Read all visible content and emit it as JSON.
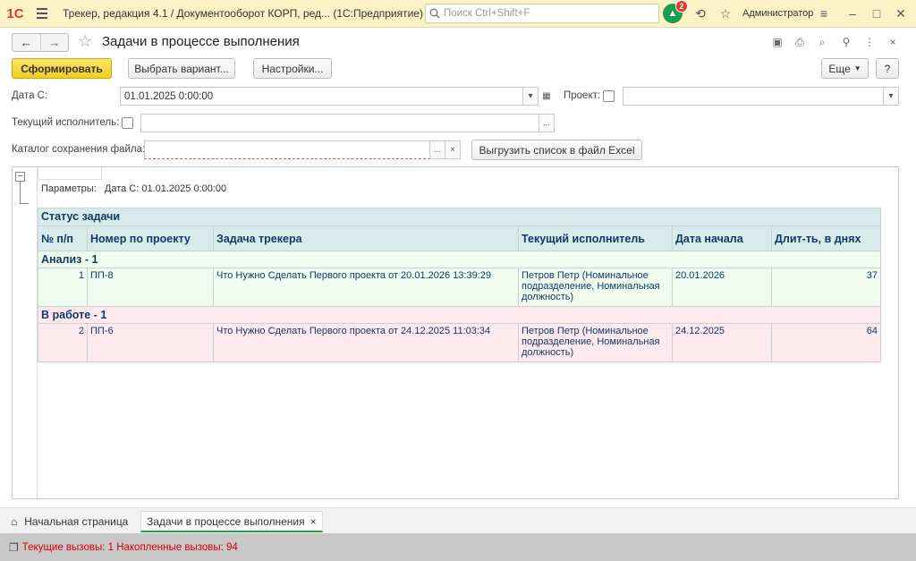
{
  "app": {
    "logo": "1С",
    "title": "Трекер, редакция 4.1 / Документооборот КОРП, ред... (1С:Предприятие)",
    "search_placeholder": "Поиск Ctrl+Shift+F",
    "notifications_count": "2",
    "user": "Администратор"
  },
  "form": {
    "title": "Задачи в процессе выполнения"
  },
  "toolbar": {
    "generate": "Сформировать",
    "choose_variant": "Выбрать вариант...",
    "settings": "Настройки...",
    "more": "Еще",
    "help": "?"
  },
  "filters": {
    "date_label": "Дата С:",
    "date_value": "01.01.2025  0:00:00",
    "project_label": "Проект:",
    "project_value": "",
    "executor_label": "Текущий исполнитель:",
    "executor_value": "",
    "folder_label": "Каталог сохранения файла:",
    "folder_value": "",
    "export_button": "Выгрузить список в файл Excel"
  },
  "report": {
    "params_label": "Параметры:",
    "params_value": "Дата С: 01.01.2025 0:00:00",
    "group_header": "Статус задачи",
    "columns": [
      "№ п/п",
      "Номер по проекту",
      "Задача трекера",
      "Текущий исполнитель",
      "Дата начала",
      "Длит-ть, в днях"
    ],
    "groups": [
      {
        "title": "Анализ - 1",
        "rows": [
          {
            "n": "1",
            "project_no": "ПП-8",
            "task": "Что Нужно Сделать Первого проекта от 20.01.2026 13:39:29",
            "executor": "Петров Петр (Номинальное подразделение, Номинальная должность)",
            "start": "20.01.2026",
            "days": "37"
          }
        ]
      },
      {
        "title": "В работе - 1",
        "rows": [
          {
            "n": "2",
            "project_no": "ПП-6",
            "task": "Что Нужно Сделать Первого проекта от 24.12.2025 11:03:34",
            "executor": "Петров Петр (Номинальное подразделение, Номинальная должность)",
            "start": "24.12.2025",
            "days": "64"
          }
        ]
      }
    ]
  },
  "tabs": [
    {
      "label": "Начальная страница"
    },
    {
      "label": "Задачи в процессе выполнения"
    }
  ],
  "status": {
    "text": "Текущие вызовы: 1   Накопленные вызовы: 94"
  },
  "colors": {
    "primary_button": "#f2cf1d",
    "status_text": "#d20000",
    "group_analysis": "#eefcee",
    "group_in_work": "#fde9ee"
  }
}
